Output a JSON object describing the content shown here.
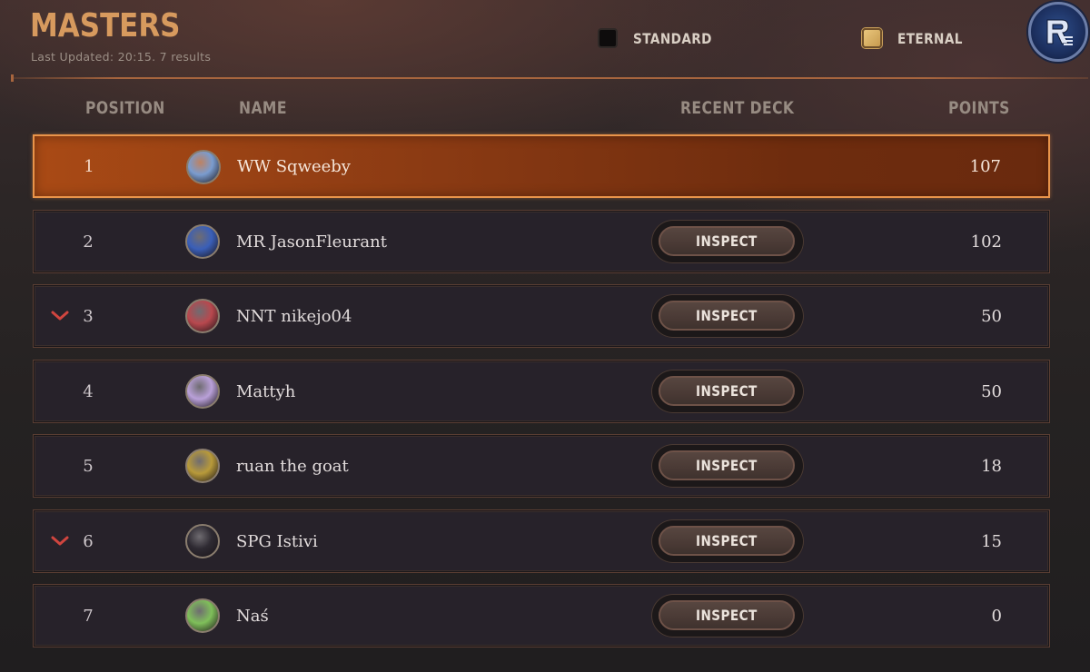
{
  "header": {
    "title": "MASTERS",
    "subtitle": "Last Updated: 20:15. 7 results"
  },
  "toggles": {
    "standard": {
      "label": "STANDARD",
      "checked": false
    },
    "eternal": {
      "label": "ETERNAL",
      "checked": true
    }
  },
  "profile_button": {
    "icon": "profile-menu-icon",
    "color": "#1c2f5e"
  },
  "columns": {
    "position": "POSITION",
    "name": "NAME",
    "recent_deck": "RECENT DECK",
    "points": "POINTS"
  },
  "inspect_label": "INSPECT",
  "rows": [
    {
      "position": "1",
      "name": "WW Sqweeby",
      "points": "107",
      "trend": "none",
      "highlighted": true,
      "has_inspect": false,
      "avatar_color": "#7a9ccf"
    },
    {
      "position": "2",
      "name": "MR JasonFleurant",
      "points": "102",
      "trend": "none",
      "highlighted": false,
      "has_inspect": true,
      "avatar_color": "#3a5fb8"
    },
    {
      "position": "3",
      "name": "NNT nikejo04",
      "points": "50",
      "trend": "down",
      "highlighted": false,
      "has_inspect": true,
      "avatar_color": "#b8484e"
    },
    {
      "position": "4",
      "name": "Mattyh",
      "points": "50",
      "trend": "none",
      "highlighted": false,
      "has_inspect": true,
      "avatar_color": "#b9a0d8"
    },
    {
      "position": "5",
      "name": "ruan the goat",
      "points": "18",
      "trend": "none",
      "highlighted": false,
      "has_inspect": true,
      "avatar_color": "#b89a3a"
    },
    {
      "position": "6",
      "name": "SPG Istivi",
      "points": "15",
      "trend": "down",
      "highlighted": false,
      "has_inspect": true,
      "avatar_color": "#2e2a32"
    },
    {
      "position": "7",
      "name": "Naś",
      "points": "0",
      "trend": "none",
      "highlighted": false,
      "has_inspect": true,
      "avatar_color": "#7fbf5a"
    }
  ],
  "colors": {
    "accent": "#d79a5e",
    "highlight_row": "#a94a15",
    "trend_down": "#d0453f"
  }
}
